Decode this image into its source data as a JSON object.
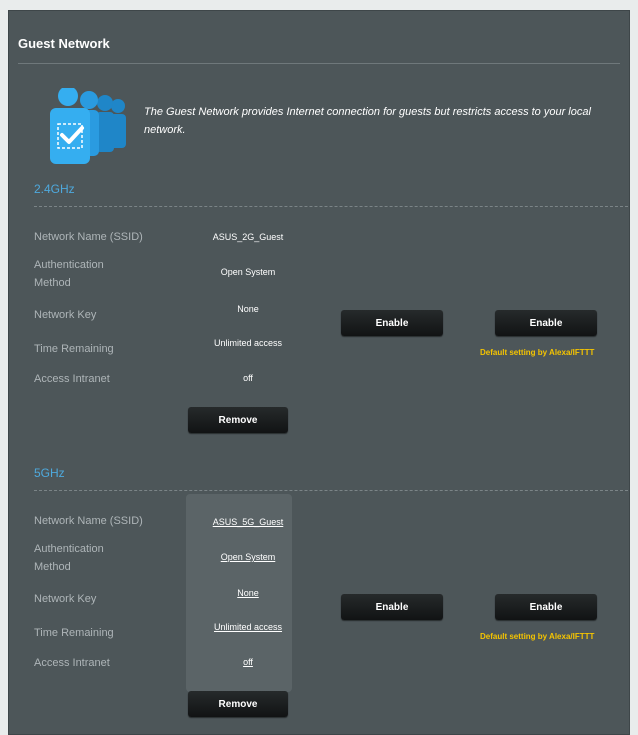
{
  "header": {
    "title": "Guest Network"
  },
  "intro": {
    "icon": "guest-users-check-icon",
    "description": "The Guest Network provides Internet connection for guests but restricts access to your local network."
  },
  "bands": [
    {
      "title": "2.4GHz",
      "fields": [
        {
          "label": "Network Name (SSID)",
          "value": "ASUS_2G_Guest"
        },
        {
          "label": "Authentication Method",
          "value": "Open System"
        },
        {
          "label": "Network Key",
          "value": "None"
        },
        {
          "label": "Time Remaining",
          "value": "Unlimited access"
        },
        {
          "label": "Access Intranet",
          "value": "off"
        }
      ],
      "remove_label": "Remove",
      "enable_label_1": "Enable",
      "enable_label_2": "Enable",
      "note": "Default setting by Alexa/IFTTT"
    },
    {
      "title": "5GHz",
      "fields": [
        {
          "label": "Network Name (SSID)",
          "value": "ASUS_5G_Guest"
        },
        {
          "label": "Authentication Method",
          "value": "Open System"
        },
        {
          "label": "Network Key",
          "value": "None"
        },
        {
          "label": "Time Remaining",
          "value": "Unlimited access"
        },
        {
          "label": "Access Intranet",
          "value": "off"
        }
      ],
      "remove_label": "Remove",
      "enable_label_1": "Enable",
      "enable_label_2": "Enable",
      "note": "Default setting by Alexa/IFTTT"
    }
  ],
  "colors": {
    "panel_bg": "#4d5659",
    "band_title": "#4ea9dd",
    "note": "#f5c400",
    "button": "#1a1d1e"
  }
}
